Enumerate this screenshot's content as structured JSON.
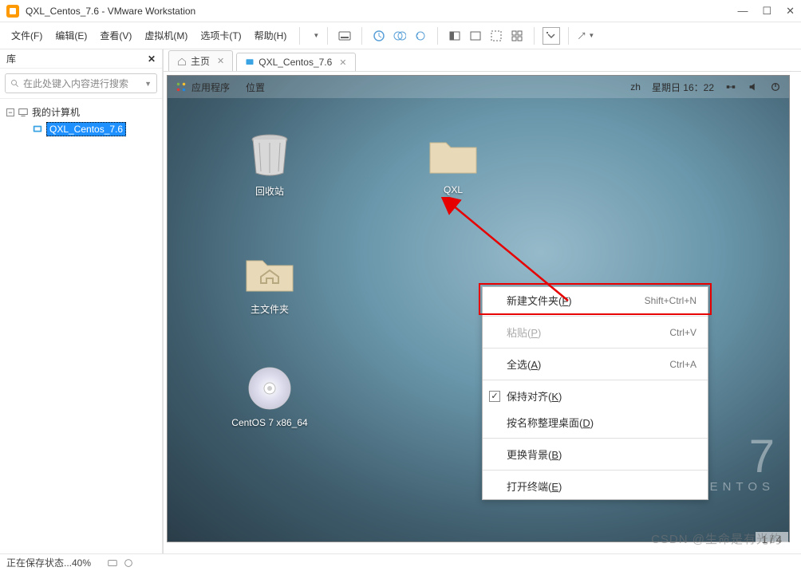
{
  "window": {
    "title": "QXL_Centos_7.6 - VMware Workstation"
  },
  "menu": {
    "file": "文件(F)",
    "edit": "编辑(E)",
    "view": "查看(V)",
    "vm": "虚拟机(M)",
    "tabs": "选项卡(T)",
    "help": "帮助(H)"
  },
  "library": {
    "title": "库",
    "search_placeholder": "在此处键入内容进行搜索",
    "root": "我的计算机",
    "vm_name": "QXL_Centos_7.6"
  },
  "tabs": {
    "home": "主页",
    "vm": "QXL_Centos_7.6"
  },
  "gnome": {
    "apps": "应用程序",
    "places": "位置",
    "lang": "zh",
    "datetime": "星期日 16：22"
  },
  "desktop": {
    "trash": "回收站",
    "qxl": "QXL",
    "home": "主文件夹",
    "iso": "CentOS 7 x86_64"
  },
  "context_menu": {
    "new_folder": {
      "label": "新建文件夹(",
      "key": "F",
      "suffix": ")",
      "shortcut": "Shift+Ctrl+N"
    },
    "paste": {
      "label": "粘贴(",
      "key": "P",
      "suffix": ")",
      "shortcut": "Ctrl+V"
    },
    "select_all": {
      "label": "全选(",
      "key": "A",
      "suffix": ")",
      "shortcut": "Ctrl+A"
    },
    "keep_aligned": {
      "label": "保持对齐(",
      "key": "K",
      "suffix": ")"
    },
    "organize": {
      "label": "按名称整理桌面(",
      "key": "D",
      "suffix": ")"
    },
    "change_bg": {
      "label": "更换背景(",
      "key": "B",
      "suffix": ")"
    },
    "open_terminal": {
      "label": "打开终端(",
      "key": "E",
      "suffix": ")"
    }
  },
  "brand": {
    "version": "7",
    "name": "CENTOS"
  },
  "page": "1 / 4",
  "status": "正在保存状态...40%",
  "watermark": "CSDN @生命是有光的"
}
